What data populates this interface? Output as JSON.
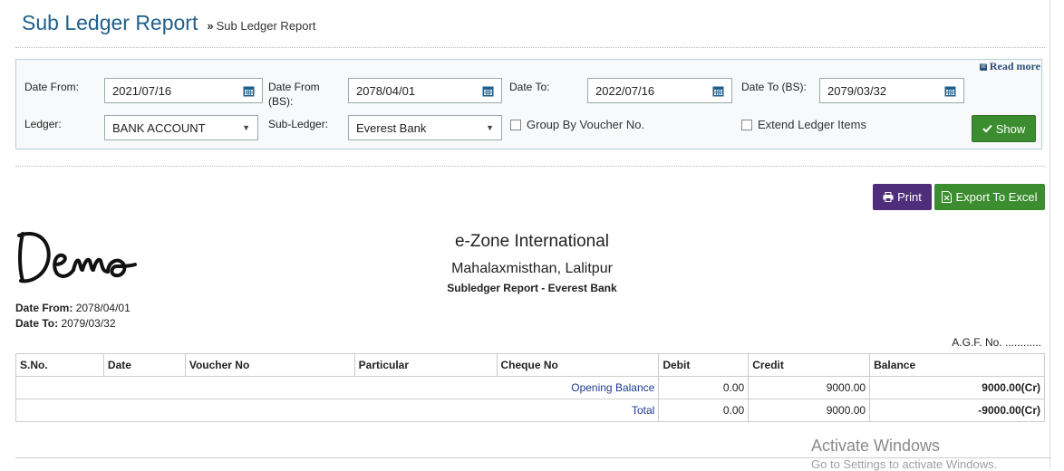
{
  "header": {
    "title": "Sub Ledger Report",
    "breadcrumb_sep": "»",
    "breadcrumb": "Sub Ledger Report"
  },
  "filters": {
    "read_more": "Read more",
    "date_from_label": "Date From:",
    "date_from_value": "2021/07/16",
    "date_from_bs_label": "Date From (BS):",
    "date_from_bs_value": "2078/04/01",
    "date_to_label": "Date To:",
    "date_to_value": "2022/07/16",
    "date_to_bs_label": "Date To (BS):",
    "date_to_bs_value": "2079/03/32",
    "ledger_label": "Ledger:",
    "ledger_value": "BANK ACCOUNT",
    "subledger_label": "Sub-Ledger:",
    "subledger_value": "Everest Bank",
    "group_by_voucher_label": "Group By Voucher No.",
    "extend_ledger_label": "Extend Ledger Items",
    "show_label": "Show"
  },
  "actions": {
    "print_label": "Print",
    "excel_label": "Export To Excel"
  },
  "report": {
    "logo_text": "Demo",
    "company_name": "e-Zone International",
    "company_address": "Mahalaxmisthan, Lalitpur",
    "subtitle": "Subledger Report - Everest Bank",
    "date_from_label": "Date From:",
    "date_from_value": "2078/04/01",
    "date_to_label": "Date To:",
    "date_to_value": "2079/03/32",
    "agf": "A.G.F. No. ............"
  },
  "table": {
    "columns": [
      "S.No.",
      "Date",
      "Voucher No",
      "Particular",
      "Cheque No",
      "Debit",
      "Credit",
      "Balance"
    ],
    "rows": [
      {
        "label": "Opening Balance",
        "debit": "0.00",
        "credit": "9000.00",
        "balance": "9000.00(Cr)"
      },
      {
        "label": "Total",
        "debit": "0.00",
        "credit": "9000.00",
        "balance": "-9000.00(Cr)"
      }
    ]
  },
  "watermark": {
    "line1": "Activate Windows",
    "line2": "Go to Settings to activate Windows."
  },
  "colors": {
    "title": "#1f5f8b",
    "show_button": "#3c8d2f",
    "print_button": "#4e2e7a",
    "excel_button": "#3c8d2f",
    "link_text": "#1f3a93"
  },
  "icons": {
    "calendar": "calendar-icon",
    "dropdown": "chevron-down-icon",
    "check": "check-icon",
    "print": "printer-icon",
    "excel": "excel-file-icon",
    "readmore": "book-icon"
  }
}
